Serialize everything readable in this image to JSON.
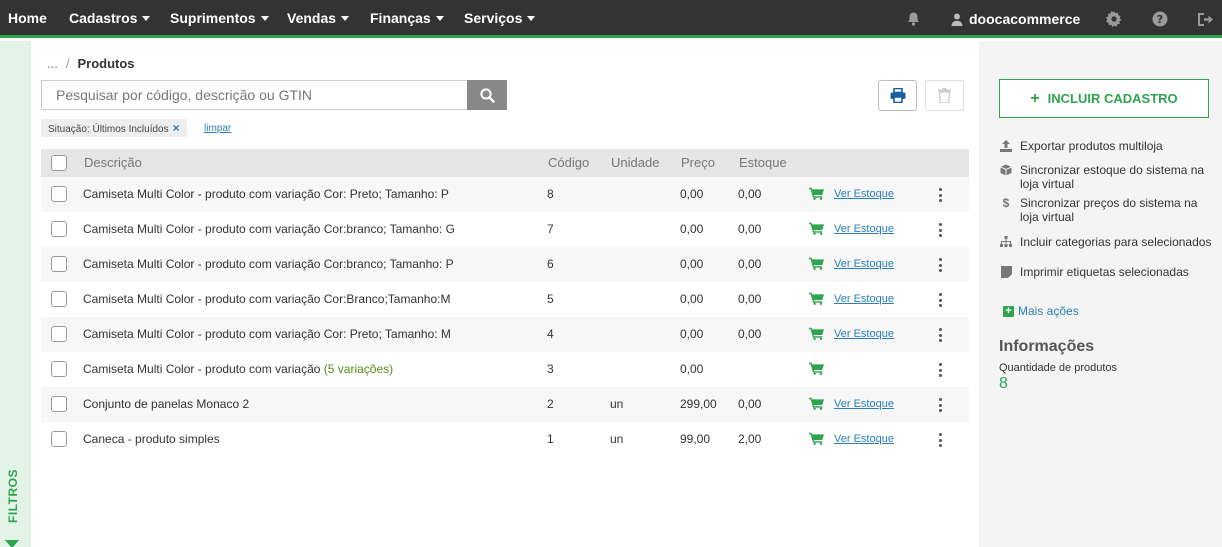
{
  "nav": {
    "items": [
      {
        "label": "Home",
        "dropdown": false
      },
      {
        "label": "Cadastros",
        "dropdown": true
      },
      {
        "label": "Suprimentos",
        "dropdown": true
      },
      {
        "label": "Vendas",
        "dropdown": true
      },
      {
        "label": "Finanças",
        "dropdown": true
      },
      {
        "label": "Serviços",
        "dropdown": true
      }
    ],
    "user": "doocacommerce",
    "accent_color": "#2ea44f"
  },
  "filters_bar": {
    "label": "FILTROS"
  },
  "breadcrumb": {
    "ellipsis": "...",
    "current": "Produtos"
  },
  "search": {
    "placeholder": "Pesquisar por código, descrição ou GTIN",
    "value": ""
  },
  "active_filter": {
    "chip": "Situação: Últimos Incluídos",
    "clear": "limpar"
  },
  "table": {
    "headers": {
      "descricao": "Descrição",
      "codigo": "Código",
      "unidade": "Unidade",
      "preco": "Preço",
      "estoque": "Estoque"
    },
    "ver_estoque_label": "Ver Estoque",
    "rows": [
      {
        "descricao": "Camiseta Multi Color - produto com variação Cor: Preto; Tamanho: P",
        "variacoes": "",
        "codigo": "8",
        "unidade": "",
        "preco": "0,00",
        "estoque": "0,00",
        "ver_estoque": true
      },
      {
        "descricao": "Camiseta Multi Color - produto com variação Cor:branco; Tamanho: G",
        "variacoes": "",
        "codigo": "7",
        "unidade": "",
        "preco": "0,00",
        "estoque": "0,00",
        "ver_estoque": true
      },
      {
        "descricao": "Camiseta Multi Color - produto com variação Cor:branco; Tamanho: P",
        "variacoes": "",
        "codigo": "6",
        "unidade": "",
        "preco": "0,00",
        "estoque": "0,00",
        "ver_estoque": true
      },
      {
        "descricao": "Camiseta Multi Color - produto com variação Cor:Branco;Tamanho:M",
        "variacoes": "",
        "codigo": "5",
        "unidade": "",
        "preco": "0,00",
        "estoque": "0,00",
        "ver_estoque": true
      },
      {
        "descricao": "Camiseta Multi Color - produto com variação Cor: Preto; Tamanho: M",
        "variacoes": "",
        "codigo": "4",
        "unidade": "",
        "preco": "0,00",
        "estoque": "0,00",
        "ver_estoque": true
      },
      {
        "descricao": "Camiseta Multi Color - produto com variação",
        "variacoes": "(5 variações)",
        "codigo": "3",
        "unidade": "",
        "preco": "0,00",
        "estoque": "",
        "ver_estoque": false
      },
      {
        "descricao": "Conjunto de panelas Monaco 2",
        "variacoes": "",
        "codigo": "2",
        "unidade": "un",
        "preco": "299,00",
        "estoque": "0,00",
        "ver_estoque": true
      },
      {
        "descricao": "Caneca - produto simples",
        "variacoes": "",
        "codigo": "1",
        "unidade": "un",
        "preco": "99,00",
        "estoque": "2,00",
        "ver_estoque": true
      }
    ]
  },
  "sidebar": {
    "incluir_button": "INCLUIR CADASTRO",
    "actions": [
      {
        "label": "Exportar produtos multiloja",
        "icon": "upload-icon"
      },
      {
        "label": "Sincronizar estoque do sistema na loja virtual",
        "icon": "cube-icon"
      },
      {
        "label": "Sincronizar preços do sistema na loja virtual",
        "icon": "dollar-icon"
      },
      {
        "label": "Incluir categorias para selecionados",
        "icon": "sitemap-icon"
      },
      {
        "label": "Imprimir etiquetas selecionadas",
        "icon": "tag-icon"
      }
    ],
    "mais_acoes": "Mais ações",
    "info_title": "Informações",
    "info_label": "Quantidade de produtos",
    "info_count": "8"
  }
}
